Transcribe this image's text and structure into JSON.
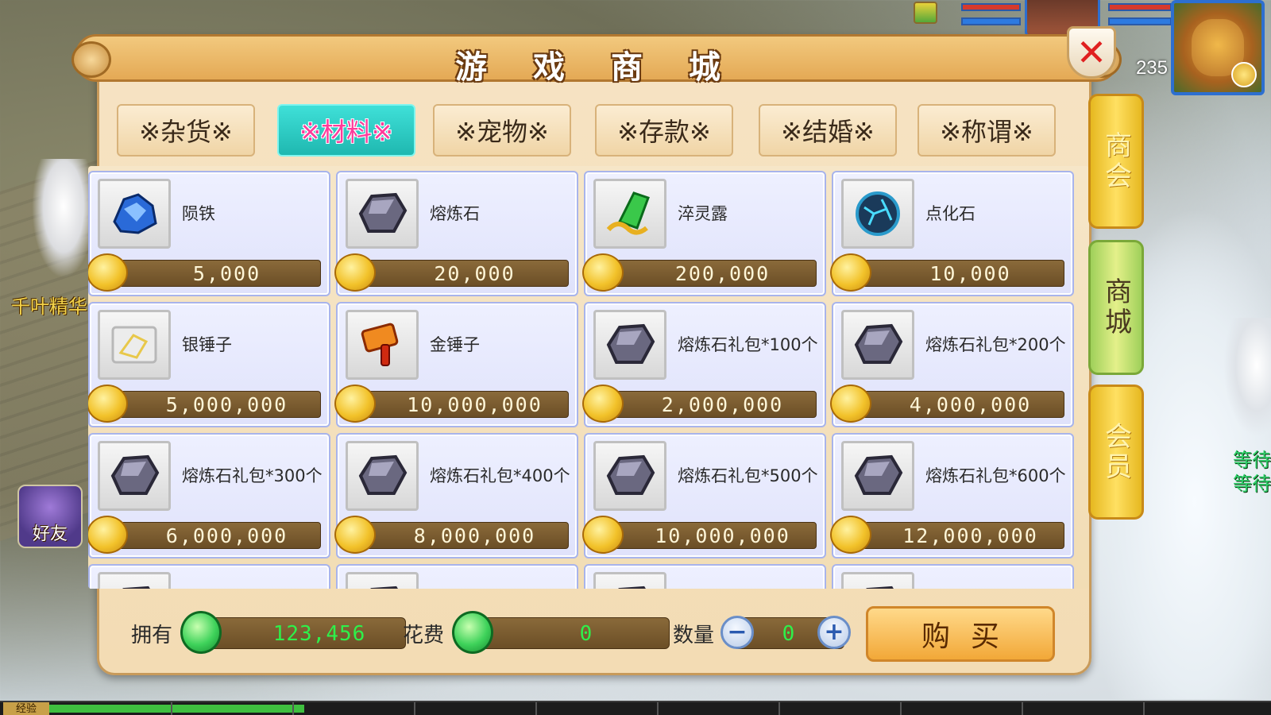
{
  "window": {
    "title": "游 戏 商 城",
    "close_label": "✕"
  },
  "hud": {
    "level": "235"
  },
  "left": {
    "npc_name": "千叶精华",
    "friends_label": "好友"
  },
  "right": {
    "waiting_1": "等待",
    "waiting_2": "等待"
  },
  "exp_label": "经验",
  "exp_progress": 0.21,
  "tabs": [
    {
      "label": "※杂货※",
      "active": false
    },
    {
      "label": "※材料※",
      "active": true
    },
    {
      "label": "※宠物※",
      "active": false
    },
    {
      "label": "※存款※",
      "active": false
    },
    {
      "label": "※结婚※",
      "active": false
    },
    {
      "label": "※称谓※",
      "active": false
    }
  ],
  "items": [
    {
      "name": "陨铁",
      "price": "5,000",
      "icon": "meteorite-icon",
      "color": "#2a6ad8"
    },
    {
      "name": "熔炼石",
      "price": "20,000",
      "icon": "smelting-stone-icon",
      "color": "#6a6880"
    },
    {
      "name": "淬灵露",
      "price": "200,000",
      "icon": "spirit-dew-icon",
      "color": "#3ac84a"
    },
    {
      "name": "点化石",
      "price": "10,000",
      "icon": "enlighten-stone-icon",
      "color": "#1a3a5a"
    },
    {
      "name": "银锤子",
      "price": "5,000,000",
      "icon": "silver-hammer-icon",
      "color": "#c8c8c8"
    },
    {
      "name": "金锤子",
      "price": "10,000,000",
      "icon": "gold-hammer-icon",
      "color": "#f08a20"
    },
    {
      "name": "熔炼石礼包*100个",
      "price": "2,000,000",
      "icon": "smelting-stone-icon",
      "color": "#6a6880"
    },
    {
      "name": "熔炼石礼包*200个",
      "price": "4,000,000",
      "icon": "smelting-stone-icon",
      "color": "#6a6880"
    },
    {
      "name": "熔炼石礼包*300个",
      "price": "6,000,000",
      "icon": "smelting-stone-icon",
      "color": "#6a6880"
    },
    {
      "name": "熔炼石礼包*400个",
      "price": "8,000,000",
      "icon": "smelting-stone-icon",
      "color": "#6a6880"
    },
    {
      "name": "熔炼石礼包*500个",
      "price": "10,000,000",
      "icon": "smelting-stone-icon",
      "color": "#6a6880"
    },
    {
      "name": "熔炼石礼包*600个",
      "price": "12,000,000",
      "icon": "smelting-stone-icon",
      "color": "#6a6880"
    },
    {
      "name": "",
      "price": "",
      "icon": "smelting-stone-icon",
      "color": "#6a6880"
    },
    {
      "name": "",
      "price": "",
      "icon": "smelting-stone-icon",
      "color": "#6a6880"
    },
    {
      "name": "",
      "price": "",
      "icon": "smelting-stone-icon",
      "color": "#6a6880"
    },
    {
      "name": "",
      "price": "",
      "icon": "smelting-stone-icon",
      "color": "#6a6880"
    }
  ],
  "footer": {
    "owned_label": "拥有",
    "owned_value": "123,456",
    "cost_label": "花费",
    "cost_value": "0",
    "quantity_label": "数量",
    "quantity_value": "0",
    "minus_label": "−",
    "plus_label": "+",
    "buy_label": "购买"
  },
  "side_tabs": [
    {
      "label": "商会",
      "style": "yellow"
    },
    {
      "label": "商城",
      "style": "green"
    },
    {
      "label": "会员",
      "style": "yellow"
    }
  ],
  "colors": {
    "active_tab": "#1fb8b0",
    "active_tab_text": "#ff3a9a",
    "price_text": "#fff6d8",
    "currency_text": "#2ef04a"
  }
}
